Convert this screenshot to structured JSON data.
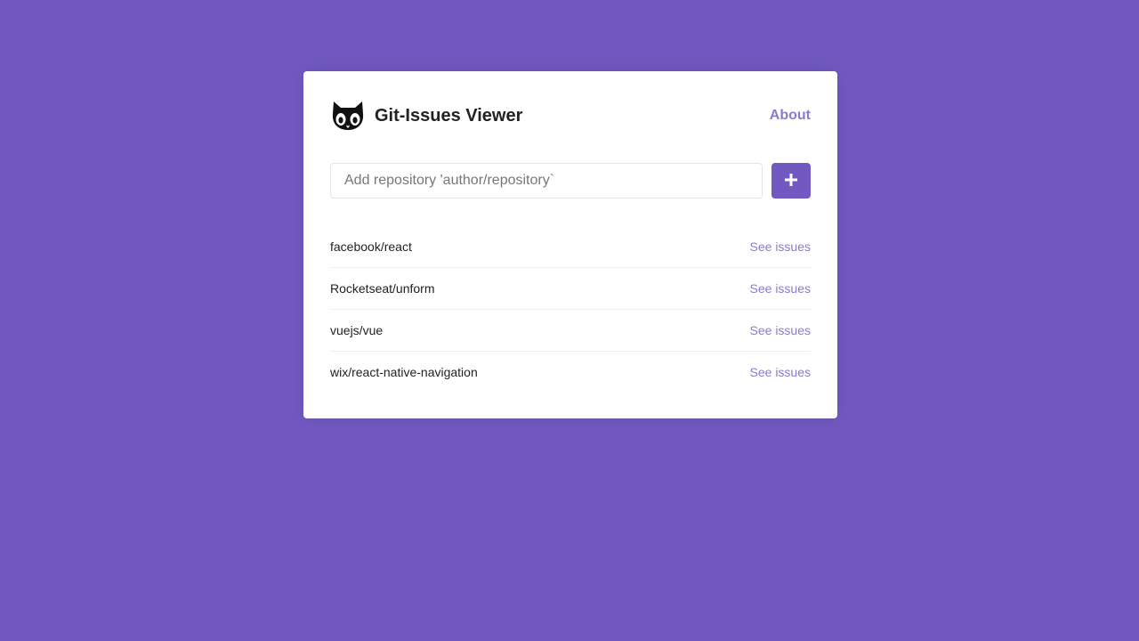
{
  "colors": {
    "background": "#7159c1",
    "accent": "#7159c1",
    "card": "#ffffff"
  },
  "header": {
    "logo_icon": "octocat-icon",
    "title": "Git-Issues Viewer",
    "about_label": "About"
  },
  "form": {
    "placeholder": "Add repository 'author/repository`",
    "value": "",
    "add_icon": "plus-icon"
  },
  "repositories": [
    {
      "name": "facebook/react",
      "link_label": "See issues"
    },
    {
      "name": "Rocketseat/unform",
      "link_label": "See issues"
    },
    {
      "name": "vuejs/vue",
      "link_label": "See issues"
    },
    {
      "name": "wix/react-native-navigation",
      "link_label": "See issues"
    }
  ]
}
